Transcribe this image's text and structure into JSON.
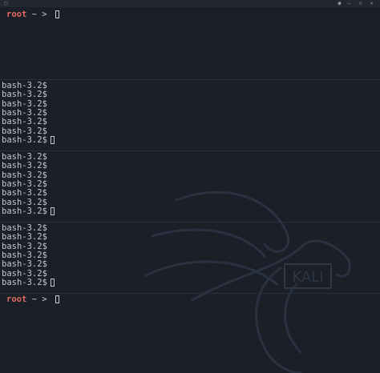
{
  "titlebar": {
    "left_icon": "window-icon",
    "right_icons": [
      "notification-icon",
      "minimize-icon",
      "maximize-icon",
      "close-icon"
    ]
  },
  "panes": [
    {
      "type": "zsh",
      "lines": [
        {
          "user": "root",
          "sep": " ~ > ",
          "cursor": true
        }
      ]
    },
    {
      "type": "bash",
      "lines": [
        {
          "text": "bash-3.2$",
          "cursor": false
        },
        {
          "text": "bash-3.2$",
          "cursor": false
        },
        {
          "text": "bash-3.2$",
          "cursor": false
        },
        {
          "text": "bash-3.2$",
          "cursor": false
        },
        {
          "text": "bash-3.2$",
          "cursor": false
        },
        {
          "text": "bash-3.2$",
          "cursor": false
        },
        {
          "text": "bash-3.2$",
          "cursor": true
        }
      ]
    },
    {
      "type": "bash",
      "lines": [
        {
          "text": "bash-3.2$",
          "cursor": false
        },
        {
          "text": "bash-3.2$",
          "cursor": false
        },
        {
          "text": "bash-3.2$",
          "cursor": false
        },
        {
          "text": "bash-3.2$",
          "cursor": false
        },
        {
          "text": "bash-3.2$",
          "cursor": false
        },
        {
          "text": "bash-3.2$",
          "cursor": false
        },
        {
          "text": "bash-3.2$",
          "cursor": true
        }
      ]
    },
    {
      "type": "bash",
      "lines": [
        {
          "text": "bash-3.2$",
          "cursor": false
        },
        {
          "text": "bash-3.2$",
          "cursor": false
        },
        {
          "text": "bash-3.2$",
          "cursor": false
        },
        {
          "text": "bash-3.2$",
          "cursor": false
        },
        {
          "text": "bash-3.2$",
          "cursor": false
        },
        {
          "text": "bash-3.2$",
          "cursor": false
        },
        {
          "text": "bash-3.2$",
          "cursor": true
        }
      ]
    },
    {
      "type": "zsh",
      "lines": [
        {
          "user": "root",
          "sep": " ~ > ",
          "cursor": true
        }
      ]
    }
  ],
  "watermark": {
    "text": "KALI"
  },
  "colors": {
    "background": "#1a1f28",
    "prompt_user": "#e06c62",
    "text": "#c5c8cf",
    "divider": "#2a3039"
  }
}
